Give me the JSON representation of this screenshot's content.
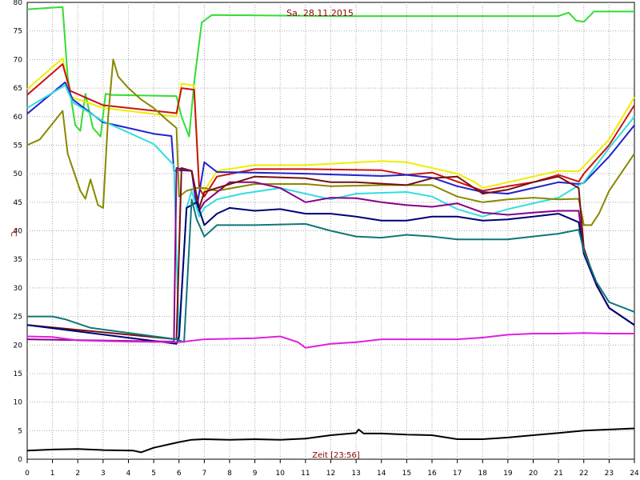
{
  "chart_data": {
    "type": "line",
    "title": "Sa. 28.11.2015",
    "xlabel": "Zeit [23:56]",
    "ylabel": "°C",
    "xlim": [
      0,
      24
    ],
    "ylim": [
      0,
      80
    ],
    "x_ticks": [
      "0",
      "1",
      "2",
      "3",
      "4",
      "5",
      "6",
      "7",
      "8",
      "9",
      "10",
      "11",
      "12",
      "13",
      "14",
      "15",
      "16",
      "17",
      "18",
      "19",
      "20",
      "21",
      "22",
      "23",
      "24"
    ],
    "y_ticks": [
      "0",
      "5",
      "10",
      "15",
      "20",
      "25",
      "30",
      "35",
      "40",
      "45",
      "50",
      "55",
      "60",
      "65",
      "70",
      "75",
      "80"
    ],
    "grid": true,
    "series": [
      {
        "color": "#33dd33",
        "points": [
          [
            0,
            78.8
          ],
          [
            1.4,
            79.2
          ],
          [
            1.6,
            67
          ],
          [
            1.9,
            58.5
          ],
          [
            2.1,
            57.5
          ],
          [
            2.3,
            64
          ],
          [
            2.6,
            58
          ],
          [
            2.9,
            56.5
          ],
          [
            3.1,
            64
          ],
          [
            3.3,
            63.8
          ],
          [
            5.9,
            63.6
          ],
          [
            6.1,
            60
          ],
          [
            6.4,
            56.5
          ],
          [
            6.6,
            66
          ],
          [
            6.9,
            76.5
          ],
          [
            7.3,
            77.8
          ],
          [
            12,
            77.6
          ],
          [
            18,
            77.6
          ],
          [
            21,
            77.6
          ],
          [
            21.4,
            78.2
          ],
          [
            21.7,
            76.8
          ],
          [
            22,
            76.6
          ],
          [
            22.4,
            78.4
          ],
          [
            24,
            78.4
          ]
        ]
      },
      {
        "color": "#eeee00",
        "points": [
          [
            0,
            64.8
          ],
          [
            1.4,
            70.2
          ],
          [
            1.7,
            63.5
          ],
          [
            3,
            61.5
          ],
          [
            5.9,
            60
          ],
          [
            6.1,
            65.8
          ],
          [
            6.6,
            65.4
          ],
          [
            6.8,
            48
          ],
          [
            7,
            47
          ],
          [
            7.5,
            50.5
          ],
          [
            9,
            51.5
          ],
          [
            11,
            51.5
          ],
          [
            14,
            52.2
          ],
          [
            15,
            52
          ],
          [
            16,
            51
          ],
          [
            17,
            50
          ],
          [
            17.7,
            48.5
          ],
          [
            18,
            47.5
          ],
          [
            19,
            48.5
          ],
          [
            20,
            49.5
          ],
          [
            21,
            50.5
          ],
          [
            21.8,
            50.4
          ],
          [
            22,
            51.3
          ],
          [
            23,
            56
          ],
          [
            24,
            63.4
          ]
        ]
      },
      {
        "color": "#cc1111",
        "points": [
          [
            0,
            63.8
          ],
          [
            1.4,
            69.2
          ],
          [
            1.7,
            64.5
          ],
          [
            3,
            62
          ],
          [
            5.9,
            60.6
          ],
          [
            6.1,
            65
          ],
          [
            6.6,
            64.7
          ],
          [
            6.8,
            47.5
          ],
          [
            7,
            46
          ],
          [
            7.5,
            49.5
          ],
          [
            9,
            50.8
          ],
          [
            11,
            50.8
          ],
          [
            14,
            50.6
          ],
          [
            15,
            49.8
          ],
          [
            16,
            50.2
          ],
          [
            17,
            48.6
          ],
          [
            18,
            47
          ],
          [
            19,
            47.8
          ],
          [
            20,
            48.5
          ],
          [
            21,
            49.8
          ],
          [
            21.8,
            48.6
          ],
          [
            22,
            50
          ],
          [
            23,
            55
          ],
          [
            24,
            62
          ]
        ]
      },
      {
        "color": "#2222cc",
        "points": [
          [
            0,
            60.5
          ],
          [
            1.5,
            66
          ],
          [
            1.8,
            63
          ],
          [
            3,
            59
          ],
          [
            4,
            58
          ],
          [
            5,
            57
          ],
          [
            5.7,
            56.6
          ],
          [
            5.8,
            50.5
          ],
          [
            6,
            50.6
          ],
          [
            6.5,
            50.5
          ],
          [
            6.7,
            44
          ],
          [
            7,
            52
          ],
          [
            7.5,
            50.3
          ],
          [
            9,
            50.2
          ],
          [
            11,
            50
          ],
          [
            14,
            49.6
          ],
          [
            15,
            49.8
          ],
          [
            16,
            49.3
          ],
          [
            17,
            47.8
          ],
          [
            18,
            46.8
          ],
          [
            19,
            46.5
          ],
          [
            20,
            47.5
          ],
          [
            21,
            48.5
          ],
          [
            21.8,
            48.2
          ],
          [
            22,
            48.4
          ],
          [
            23,
            53
          ],
          [
            24,
            58.5
          ]
        ]
      },
      {
        "color": "#33dddd",
        "points": [
          [
            0,
            61.5
          ],
          [
            1.5,
            65.5
          ],
          [
            1.8,
            62.5
          ],
          [
            3,
            59.2
          ],
          [
            4,
            57.2
          ],
          [
            5,
            55.2
          ],
          [
            5.8,
            51.5
          ],
          [
            6,
            20.5
          ],
          [
            6.3,
            44
          ],
          [
            6.5,
            47
          ],
          [
            6.8,
            42.5
          ],
          [
            7,
            44
          ],
          [
            7.5,
            45.5
          ],
          [
            8.5,
            46.5
          ],
          [
            10,
            47.5
          ],
          [
            11,
            46.5
          ],
          [
            12,
            45.5
          ],
          [
            13,
            46.5
          ],
          [
            15,
            46.8
          ],
          [
            16,
            46
          ],
          [
            17,
            43.8
          ],
          [
            18,
            42.5
          ],
          [
            19,
            43.8
          ],
          [
            20,
            44.8
          ],
          [
            21,
            45.8
          ],
          [
            22,
            48.5
          ],
          [
            23,
            54.5
          ],
          [
            24,
            60
          ]
        ]
      },
      {
        "color": "#888800",
        "points": [
          [
            0,
            55
          ],
          [
            0.5,
            56
          ],
          [
            1.4,
            61
          ],
          [
            1.6,
            53.5
          ],
          [
            2.1,
            47
          ],
          [
            2.3,
            45.6
          ],
          [
            2.5,
            49
          ],
          [
            2.8,
            44.5
          ],
          [
            3,
            44
          ],
          [
            3.2,
            60
          ],
          [
            3.4,
            70
          ],
          [
            3.6,
            67
          ],
          [
            4,
            65
          ],
          [
            4.5,
            63
          ],
          [
            5,
            61.5
          ],
          [
            5.5,
            59.5
          ],
          [
            5.9,
            58
          ],
          [
            6,
            46
          ],
          [
            6.3,
            47
          ],
          [
            6.7,
            47.5
          ],
          [
            7,
            47.5
          ],
          [
            7.5,
            47
          ],
          [
            9,
            48.2
          ],
          [
            11,
            48.2
          ],
          [
            12,
            47.8
          ],
          [
            14,
            48
          ],
          [
            16,
            48
          ],
          [
            17,
            46
          ],
          [
            18,
            45
          ],
          [
            19,
            45.5
          ],
          [
            20,
            45.8
          ],
          [
            21,
            45.5
          ],
          [
            21.8,
            45.6
          ],
          [
            22,
            41
          ],
          [
            22.3,
            41
          ],
          [
            22.6,
            43
          ],
          [
            23,
            47
          ],
          [
            24,
            53.5
          ]
        ]
      },
      {
        "color": "#880088",
        "points": [
          [
            0,
            21
          ],
          [
            5.8,
            20.6
          ],
          [
            5.9,
            51
          ],
          [
            6.5,
            50.5
          ],
          [
            6.8,
            43.5
          ],
          [
            7,
            45
          ],
          [
            8,
            48.5
          ],
          [
            9,
            48.5
          ],
          [
            10,
            47.5
          ],
          [
            11,
            45
          ],
          [
            12,
            45.8
          ],
          [
            13,
            45.7
          ],
          [
            14,
            45
          ],
          [
            15,
            44.5
          ],
          [
            16,
            44.2
          ],
          [
            17,
            44.8
          ],
          [
            18,
            43.2
          ],
          [
            19,
            42.8
          ],
          [
            20,
            43.2
          ],
          [
            21,
            43.5
          ],
          [
            21.8,
            43.5
          ],
          [
            22,
            36
          ],
          [
            22.5,
            30.5
          ],
          [
            23,
            26.5
          ],
          [
            24,
            23.5
          ]
        ]
      },
      {
        "color": "#771111",
        "points": [
          [
            0,
            23.5
          ],
          [
            5.9,
            21
          ],
          [
            6.1,
            51
          ],
          [
            6.5,
            50.5
          ],
          [
            6.8,
            44
          ],
          [
            7,
            46.8
          ],
          [
            7.5,
            47.5
          ],
          [
            9,
            49.5
          ],
          [
            11,
            49.2
          ],
          [
            12,
            48.5
          ],
          [
            13,
            48.5
          ],
          [
            15,
            48
          ],
          [
            16,
            49.2
          ],
          [
            17,
            49.5
          ],
          [
            17.5,
            48
          ],
          [
            18,
            46.5
          ],
          [
            19,
            47.2
          ],
          [
            20,
            48.5
          ],
          [
            21,
            49.5
          ],
          [
            21.8,
            47.5
          ],
          [
            22,
            37
          ],
          [
            22.5,
            30.5
          ],
          [
            23,
            26.5
          ],
          [
            24,
            23.5
          ]
        ]
      },
      {
        "color": "#000077",
        "points": [
          [
            0,
            23.5
          ],
          [
            5.9,
            20.2
          ],
          [
            6,
            21.5
          ],
          [
            6.3,
            44
          ],
          [
            6.7,
            45
          ],
          [
            7,
            41
          ],
          [
            7.5,
            43
          ],
          [
            8,
            44
          ],
          [
            9,
            43.5
          ],
          [
            10,
            43.8
          ],
          [
            11,
            43
          ],
          [
            12,
            43
          ],
          [
            13,
            42.5
          ],
          [
            14,
            41.8
          ],
          [
            15,
            41.8
          ],
          [
            16,
            42.5
          ],
          [
            17,
            42.5
          ],
          [
            18,
            41.8
          ],
          [
            19,
            42
          ],
          [
            20,
            42.5
          ],
          [
            21,
            43
          ],
          [
            21.8,
            41.5
          ],
          [
            22,
            36
          ],
          [
            22.5,
            30.5
          ],
          [
            23,
            26.5
          ],
          [
            24,
            23.5
          ]
        ]
      },
      {
        "color": "#117777",
        "points": [
          [
            0,
            25
          ],
          [
            1,
            25
          ],
          [
            1.5,
            24.5
          ],
          [
            2.5,
            23
          ],
          [
            5.9,
            21
          ],
          [
            6.2,
            20.5
          ],
          [
            6.5,
            45.5
          ],
          [
            6.7,
            42
          ],
          [
            7,
            39
          ],
          [
            7.5,
            41
          ],
          [
            9,
            41
          ],
          [
            11,
            41.2
          ],
          [
            12,
            40
          ],
          [
            13,
            39
          ],
          [
            14,
            38.8
          ],
          [
            15,
            39.3
          ],
          [
            16,
            39
          ],
          [
            17,
            38.5
          ],
          [
            19,
            38.5
          ],
          [
            20,
            39
          ],
          [
            21,
            39.5
          ],
          [
            21.8,
            40.2
          ],
          [
            22,
            36.5
          ],
          [
            22.5,
            31
          ],
          [
            23,
            27.5
          ],
          [
            24,
            25.8
          ]
        ]
      },
      {
        "color": "#dd22dd",
        "points": [
          [
            0,
            21.5
          ],
          [
            1,
            21.4
          ],
          [
            2,
            20.8
          ],
          [
            4,
            20.6
          ],
          [
            6,
            20.5
          ],
          [
            7,
            21
          ],
          [
            9,
            21.2
          ],
          [
            10,
            21.5
          ],
          [
            10.7,
            20.5
          ],
          [
            11,
            19.5
          ],
          [
            12,
            20.2
          ],
          [
            13,
            20.5
          ],
          [
            14,
            21
          ],
          [
            15,
            21
          ],
          [
            17,
            21
          ],
          [
            18,
            21.3
          ],
          [
            19,
            21.8
          ],
          [
            20,
            22
          ],
          [
            21,
            22
          ],
          [
            22,
            22.1
          ],
          [
            23,
            22
          ],
          [
            24,
            22
          ]
        ]
      },
      {
        "color": "#000000",
        "points": [
          [
            0,
            1.5
          ],
          [
            1,
            1.7
          ],
          [
            2,
            1.8
          ],
          [
            3,
            1.6
          ],
          [
            4.2,
            1.5
          ],
          [
            4.5,
            1.2
          ],
          [
            5,
            2
          ],
          [
            6,
            3
          ],
          [
            6.5,
            3.4
          ],
          [
            7,
            3.5
          ],
          [
            8,
            3.4
          ],
          [
            9,
            3.5
          ],
          [
            10,
            3.4
          ],
          [
            11,
            3.6
          ],
          [
            12,
            4.2
          ],
          [
            13,
            4.6
          ],
          [
            13.1,
            5.2
          ],
          [
            13.3,
            4.5
          ],
          [
            14,
            4.5
          ],
          [
            15,
            4.3
          ],
          [
            16,
            4.2
          ],
          [
            17,
            3.5
          ],
          [
            18,
            3.5
          ],
          [
            19,
            3.8
          ],
          [
            20,
            4.2
          ],
          [
            21,
            4.6
          ],
          [
            22,
            5
          ],
          [
            23,
            5.2
          ],
          [
            24,
            5.4
          ]
        ]
      }
    ]
  }
}
